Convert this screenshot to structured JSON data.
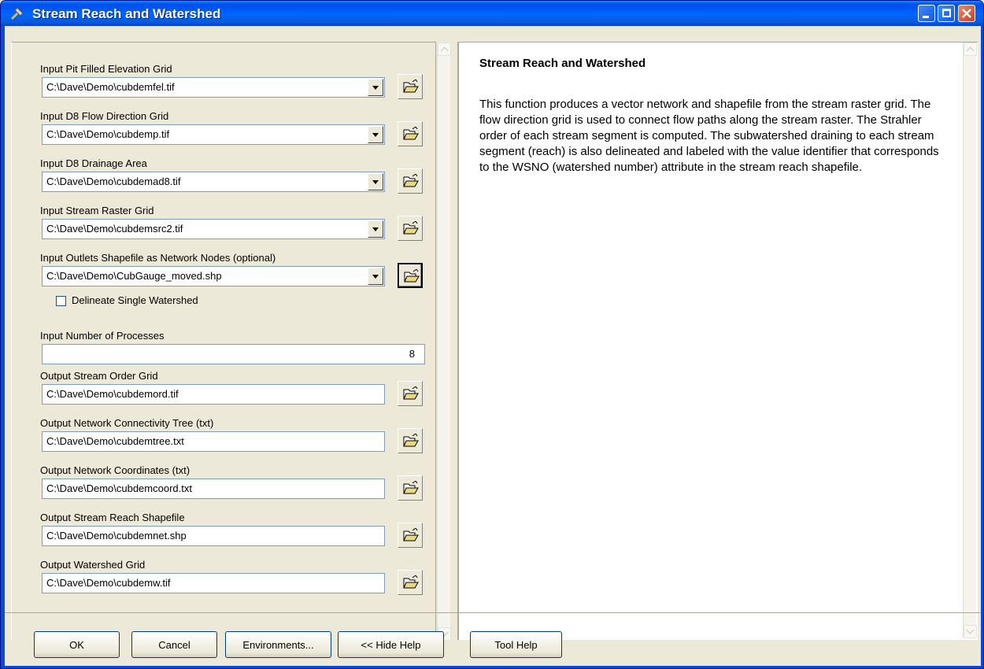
{
  "window": {
    "title": "Stream Reach and Watershed"
  },
  "form": {
    "fields": [
      {
        "label": "Input Pit Filled Elevation Grid",
        "value": "C:\\Dave\\Demo\\cubdemfel.tif"
      },
      {
        "label": "Input D8 Flow Direction Grid",
        "value": "C:\\Dave\\Demo\\cubdemp.tif"
      },
      {
        "label": "Input D8 Drainage Area",
        "value": "C:\\Dave\\Demo\\cubdemad8.tif"
      },
      {
        "label": "Input Stream Raster Grid",
        "value": "C:\\Dave\\Demo\\cubdemsrc2.tif"
      },
      {
        "label": "Input Outlets Shapefile as Network Nodes (optional)",
        "value": "C:\\Dave\\Demo\\CubGauge_moved.shp"
      }
    ],
    "checkbox": {
      "label": "Delineate Single Watershed",
      "checked": false
    },
    "processes": {
      "label": "Input Number of Processes",
      "value": "8"
    },
    "outputs": [
      {
        "label": "Output Stream Order Grid",
        "value": "C:\\Dave\\Demo\\cubdemord.tif"
      },
      {
        "label": "Output Network Connectivity Tree (txt)",
        "value": "C:\\Dave\\Demo\\cubdemtree.txt"
      },
      {
        "label": "Output Network Coordinates (txt)",
        "value": "C:\\Dave\\Demo\\cubdemcoord.txt"
      },
      {
        "label": "Output Stream Reach Shapefile",
        "value": "C:\\Dave\\Demo\\cubdemnet.shp"
      },
      {
        "label": "Output Watershed Grid",
        "value": "C:\\Dave\\Demo\\cubdemw.tif"
      }
    ]
  },
  "help": {
    "title": "Stream Reach and Watershed",
    "body": "This function produces a vector network and shapefile from the stream raster grid. The flow direction grid is used to connect flow paths along the stream raster. The Strahler order of each stream segment is computed. The subwatershed draining to each stream segment (reach) is also delineated and labeled with the value identifier that corresponds to the WSNO (watershed number) attribute in the stream reach shapefile."
  },
  "buttons": {
    "ok": "OK",
    "cancel": "Cancel",
    "environments": "Environments...",
    "hide_help": "<< Hide Help",
    "tool_help": "Tool Help"
  },
  "icons": {
    "title": "hammer-icon",
    "browse": "open-folder-icon",
    "minimize": "minimize-icon",
    "maximize": "maximize-icon",
    "close": "close-icon"
  },
  "colors": {
    "titlebar": "#0a5ad8",
    "dialog_bg": "#ece9d8",
    "close_button": "#c6421f"
  }
}
